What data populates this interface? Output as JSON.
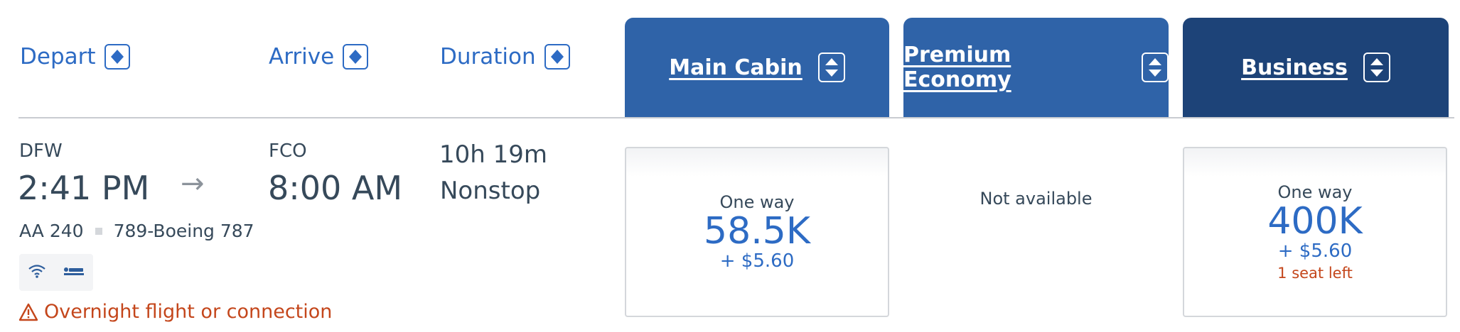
{
  "headers": {
    "depart": "Depart",
    "arrive": "Arrive",
    "duration": "Duration"
  },
  "cabins": [
    {
      "label": "Main Cabin",
      "color": "#2f63a8"
    },
    {
      "label": "Premium Economy",
      "color": "#2f63a8"
    },
    {
      "label": "Business",
      "color": "#1d4378"
    }
  ],
  "flight": {
    "origin": "DFW",
    "depart_time": "2:41 PM",
    "arrow": "→",
    "destination": "FCO",
    "arrive_time": "8:00 AM",
    "duration": "10h 19m",
    "stops": "Nonstop",
    "flight_number": "AA 240",
    "aircraft": "789-Boeing 787",
    "amenities": [
      "wifi-icon",
      "lie-flat-seat-icon"
    ],
    "warning": "Overnight flight or connection"
  },
  "fares": {
    "main": {
      "oneway": "One way",
      "miles": "58.5K",
      "tax": "+ $5.60"
    },
    "premium": {
      "status": "Not available"
    },
    "business": {
      "oneway": "One way",
      "miles": "400K",
      "tax": "+ $5.60",
      "seats": "1 seat left"
    }
  },
  "colors": {
    "link_blue": "#2d6bc4",
    "text": "#36495a",
    "warning": "#c4461b",
    "main_cabin": "#2f63a8",
    "business": "#1d4378"
  }
}
